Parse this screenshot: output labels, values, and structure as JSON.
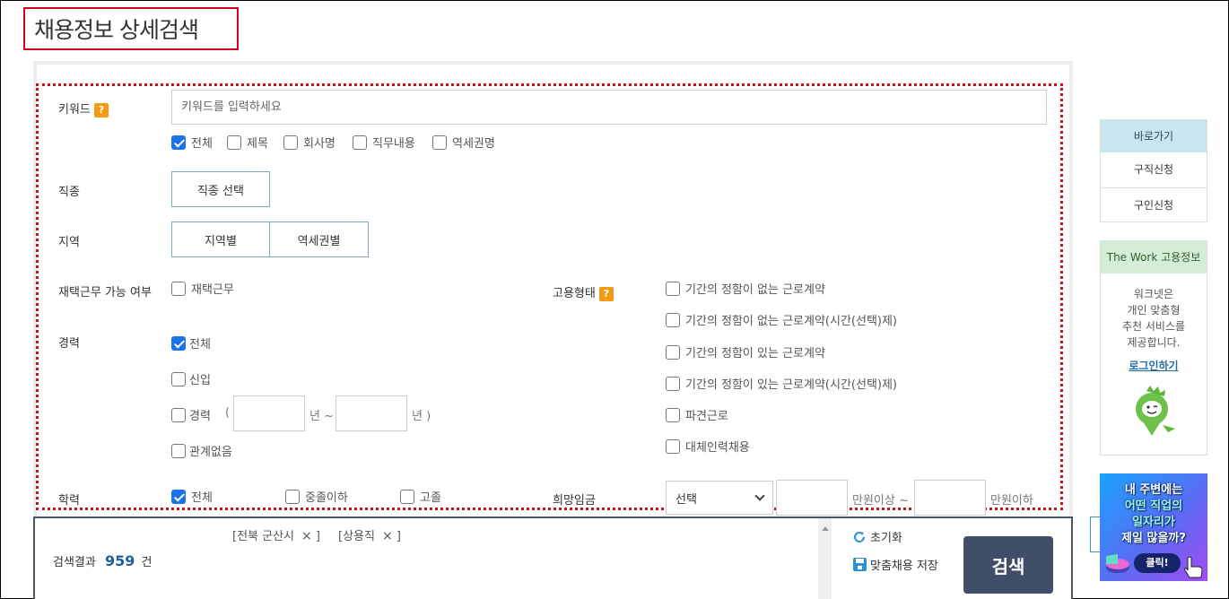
{
  "page": {
    "title": "채용정보 상세검색"
  },
  "keyword": {
    "label": "키워드",
    "help": "?",
    "placeholder": "키워드를 입력하세요",
    "value": "",
    "scopes": [
      {
        "label": "전체",
        "checked": true
      },
      {
        "label": "제목",
        "checked": false
      },
      {
        "label": "회사명",
        "checked": false
      },
      {
        "label": "직무내용",
        "checked": false
      },
      {
        "label": "역세권명",
        "checked": false
      }
    ]
  },
  "job_type": {
    "label": "직종",
    "button": "직종 선택"
  },
  "region": {
    "label": "지역",
    "buttons": [
      "지역별",
      "역세권별"
    ]
  },
  "remote": {
    "label": "재택근무 가능 여부",
    "option": {
      "label": "재택근무",
      "checked": false
    }
  },
  "career": {
    "label": "경력",
    "options": [
      {
        "label": "전체",
        "checked": true
      },
      {
        "label": "신입",
        "checked": false
      },
      {
        "label": "경력",
        "checked": false
      },
      {
        "label": "관계없음",
        "checked": false
      }
    ],
    "range": {
      "open": "(",
      "from_value": "",
      "unit_from": "년 ~",
      "to_value": "",
      "unit_to": "년 )"
    }
  },
  "education": {
    "label": "학력",
    "options": [
      {
        "label": "전체",
        "checked": true
      },
      {
        "label": "중졸이하",
        "checked": false
      },
      {
        "label": "고졸",
        "checked": false
      }
    ]
  },
  "employment": {
    "label": "고용형태",
    "help": "?",
    "options": [
      {
        "label": "기간의 정함이 없는 근로계약",
        "checked": false
      },
      {
        "label": "기간의 정함이 없는 근로계약(시간(선택)제)",
        "checked": false
      },
      {
        "label": "기간의 정함이 있는 근로계약",
        "checked": false
      },
      {
        "label": "기간의 정함이 있는 근로계약(시간(선택)제)",
        "checked": false
      },
      {
        "label": "파견근로",
        "checked": false
      },
      {
        "label": "대체인력채용",
        "checked": false
      }
    ]
  },
  "salary": {
    "label": "희망임금",
    "select": "선택",
    "min_value": "",
    "min_unit": "만원이상 ~",
    "max_value": "",
    "max_unit": "만원이하"
  },
  "results": {
    "tags": [
      {
        "open": "[전북 군산시",
        "close": "×",
        "end": "]"
      },
      {
        "open": "[상용직",
        "close": "×",
        "end": "]"
      }
    ],
    "label": "검색결과",
    "count": "959",
    "unit": "건",
    "reset": "초기화",
    "save": "맞춤채용 저장",
    "search": "검색"
  },
  "sidebar": {
    "shortcut": {
      "title": "바로가기",
      "items": [
        "구직신청",
        "구인신청"
      ],
      "head_color": "#c8e6ef"
    },
    "thework": {
      "title": "The Work 고용정보",
      "lines": [
        "워크넷은",
        "개인 맞춤형",
        "추천 서비스를",
        "제공합니다."
      ],
      "login": "로그인하기",
      "head_color": "#d4edd6"
    },
    "ad": {
      "lines": [
        "내 주변에는",
        "어떤 직업의",
        "일자리가",
        "제일 많을까?"
      ],
      "click": "클릭!"
    }
  },
  "colors": {
    "accent_red": "#d0021b",
    "check_blue": "#1a73e8",
    "help_orange": "#f39c12",
    "search_button": "#414e68",
    "count_blue": "#1f5fa0"
  }
}
